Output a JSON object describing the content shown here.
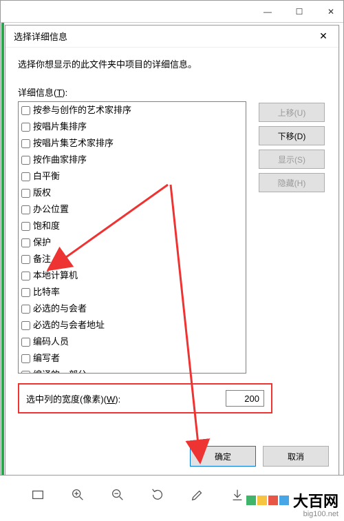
{
  "outer_window": {
    "minimize": "—",
    "maximize": "☐",
    "close": "✕"
  },
  "dialog": {
    "title": "选择详细信息",
    "close": "✕",
    "instruction": "选择你想显示的此文件夹中项目的详细信息。",
    "section_label_prefix": "详细信息(",
    "section_label_key": "T",
    "section_label_suffix": "):",
    "checklist": [
      "按参与创作的艺术家排序",
      "按唱片集排序",
      "按唱片集艺术家排序",
      "按作曲家排序",
      "白平衡",
      "版权",
      "办公位置",
      "饱和度",
      "保护",
      "备注",
      "本地计算机",
      "比特率",
      "必选的与会者",
      "必选的与会者地址",
      "编码人员",
      "编写者",
      "编译的一部分"
    ],
    "side_buttons": {
      "move_up": "上移(U)",
      "move_down": "下移(D)",
      "show": "显示(S)",
      "hide": "隐藏(H)"
    },
    "width_row": {
      "label_prefix": "选中列的宽度(像素)(",
      "label_key": "W",
      "label_suffix": "):",
      "value": "200"
    },
    "footer": {
      "ok": "确定",
      "cancel": "取消"
    }
  },
  "logo": {
    "text": "大百网",
    "sub": "big100.net",
    "colors": [
      "#3fb46a",
      "#f6c441",
      "#e85745",
      "#47a6e6"
    ]
  }
}
